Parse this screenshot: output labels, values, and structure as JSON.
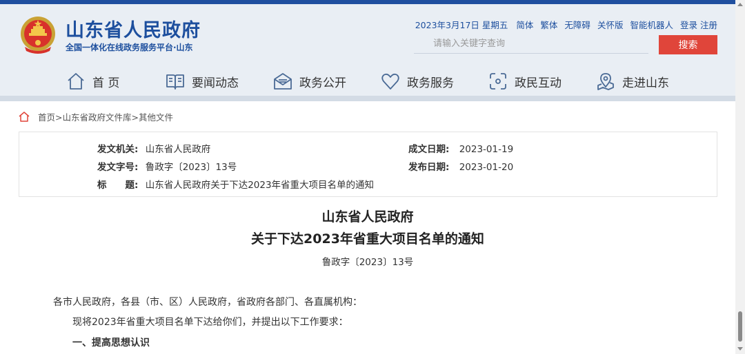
{
  "header": {
    "site_name": "山东省人民政府",
    "site_subtitle": "全国一体化在线政务服务平台·山东",
    "date": "2023年3月17日 星期五",
    "util_links": [
      "简体",
      "繁体",
      "无障碍",
      "关怀版",
      "智能机器人",
      "登录",
      "注册"
    ],
    "search_placeholder": "请输入关键字查询",
    "search_button": "搜索",
    "emblem_icon": "national-emblem-icon",
    "colors": {
      "brand_blue": "#1d4f9e",
      "search_red": "#e0453a",
      "header_bg": "#e9eef4"
    }
  },
  "nav": [
    {
      "label": "首 页",
      "icon": "home-icon"
    },
    {
      "label": "要闻动态",
      "icon": "book-icon"
    },
    {
      "label": "政务公开",
      "icon": "mail-icon"
    },
    {
      "label": "政务服务",
      "icon": "heart-icon"
    },
    {
      "label": "政民互动",
      "icon": "interaction-icon"
    },
    {
      "label": "走进山东",
      "icon": "location-icon"
    }
  ],
  "breadcrumb": {
    "icon": "home-icon",
    "items": [
      "首页",
      "山东省政府文件库",
      "其他文件"
    ],
    "separator": ">"
  },
  "meta": {
    "issuer_label": "发文机关:",
    "issuer_value": "山东省人民政府",
    "docno_label": "发文字号:",
    "docno_value": "鲁政字〔2023〕13号",
    "title_label": "标　　题:",
    "title_value": "山东省人民政府关于下达2023年省重大项目名单的通知",
    "written_label": "成文日期:",
    "written_value": "2023-01-19",
    "published_label": "发布日期:",
    "published_value": "2023-01-20"
  },
  "document": {
    "title_line1": "山东省人民政府",
    "title_line2": "关于下达2023年省重大项目名单的通知",
    "number": "鲁政字〔2023〕13号",
    "salutation": "各市人民政府，各县（市、区）人民政府，省政府各部门、各直属机构：",
    "intro": "现将2023年省重大项目名单下达给你们，并提出以下工作要求：",
    "section1": "一、提高思想认识"
  }
}
